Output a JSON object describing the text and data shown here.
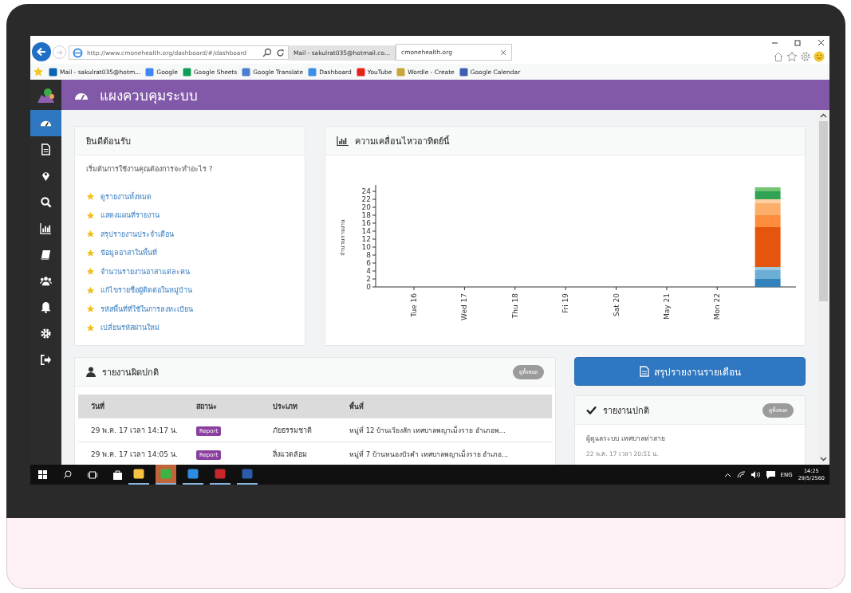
{
  "browser": {
    "url": "http://www.cmonehealth.org/dashboard/#/dashboard",
    "tabs": [
      {
        "label": "Mail - sakulrat035@hotmail.co...",
        "selected": false
      },
      {
        "label": "cmonehealth.org",
        "selected": true
      }
    ],
    "bookmarks": [
      "Mail - sakulrat035@hotm...",
      "Google",
      "Google Sheets",
      "Google Translate",
      "Dashboard",
      "YouTube",
      "Wordle - Create",
      "Google Calendar"
    ]
  },
  "app": {
    "title": "แผงควบคุมระบบ",
    "sidebar": [
      {
        "selected": true
      },
      {
        "selected": false
      },
      {
        "selected": false
      },
      {
        "selected": false
      },
      {
        "selected": false
      },
      {
        "selected": false
      },
      {
        "selected": false
      },
      {
        "selected": false
      },
      {
        "selected": false
      },
      {
        "selected": false
      }
    ]
  },
  "welcome": {
    "title": "ยินดีต้อนรับ",
    "prompt": "เริ่มต้นการใช้งานคุณต้องการจะทำอะไร ?",
    "links": [
      "ดูรายงานทั้งหมด",
      "แสดงแผนที่รายงาน",
      "สรุปรายงานประจำเดือน",
      "ข้อมูลอาสาในพื้นที่",
      "จำนวนรายงานอาสาแต่ละคน",
      "แก้ไขรายชื่อผู้ติดต่อในหมู่บ้าน",
      "รหัสพื้นที่ที่ใช้ในการลงทะเบียน",
      "เปลี่ยนรหัสผ่านใหม่"
    ]
  },
  "activity": {
    "title": "ความเคลื่อนไหวอาทิตย์นี้",
    "chart_data": {
      "type": "bar",
      "stacked": true,
      "ylabel": "จำนวนรายงาน",
      "categories": [
        "Tue 16",
        "Wed 17",
        "Thu 18",
        "Fri 19",
        "Sat 20",
        "May 21",
        "Mon 22",
        null
      ],
      "ylim": [
        0,
        25
      ],
      "yticks": [
        0,
        2,
        4,
        6,
        8,
        10,
        12,
        14,
        16,
        18,
        20,
        22,
        24
      ],
      "series": [
        {
          "color": "#3182bd",
          "values": [
            null,
            null,
            null,
            null,
            null,
            null,
            null,
            2
          ]
        },
        {
          "color": "#6baed6",
          "values": [
            null,
            null,
            null,
            null,
            null,
            null,
            null,
            2.2
          ]
        },
        {
          "color": "#9ecae1",
          "values": [
            null,
            null,
            null,
            null,
            null,
            null,
            null,
            0.8
          ]
        },
        {
          "color": "#e6550d",
          "values": [
            null,
            null,
            null,
            null,
            null,
            null,
            null,
            10
          ]
        },
        {
          "color": "#fd8d3c",
          "values": [
            null,
            null,
            null,
            null,
            null,
            null,
            null,
            3
          ]
        },
        {
          "color": "#fdae6b",
          "values": [
            null,
            null,
            null,
            null,
            null,
            null,
            null,
            3
          ]
        },
        {
          "color": "#fdd0a2",
          "values": [
            null,
            null,
            null,
            null,
            null,
            null,
            null,
            1
          ]
        },
        {
          "color": "#31a354",
          "values": [
            null,
            null,
            null,
            null,
            null,
            null,
            null,
            2
          ]
        },
        {
          "color": "#74c476",
          "values": [
            null,
            null,
            null,
            null,
            null,
            null,
            null,
            1
          ]
        }
      ]
    }
  },
  "abnormal": {
    "title": "รายงานผิดปกติ",
    "view_all": "ดูทั้งหมด",
    "columns": [
      "วันที่",
      "สถานะ",
      "ประเภท",
      "พื้นที่"
    ],
    "rows": [
      {
        "date": "29 พ.ค. 17 เวลา 14:17 น.",
        "status": "Report",
        "type": "ภัยธรรมชาติ",
        "area": "หมู่ที่ 12 บ้านเวียงสัก เทศบาลพญาเม็งราย อำเภอพ..."
      },
      {
        "date": "29 พ.ค. 17 เวลา 14:05 น.",
        "status": "Report",
        "type": "สิ่งแวดล้อม",
        "area": "หมู่ที่ 7 บ้านหนองบัวคำ เทศบาลพญาเม็งราย อำเภอ..."
      }
    ]
  },
  "monthly_button": "สรุปรายงานรายเดือน",
  "normal": {
    "title": "รายงานปกติ",
    "view_all": "ดูทั้งหมด",
    "items": [
      {
        "text": "ผู้ดูแลระบบ เทศบาลท่าสาย",
        "time": "22 พ.ค. 17 เวลา 20:51 น."
      }
    ]
  },
  "taskbar": {
    "apps": [
      {
        "active": false
      },
      {
        "active": true
      },
      {
        "active": false
      },
      {
        "active": false
      },
      {
        "active": false
      }
    ],
    "language": "ENG",
    "time": "14:25",
    "date": "29/5/2560"
  }
}
